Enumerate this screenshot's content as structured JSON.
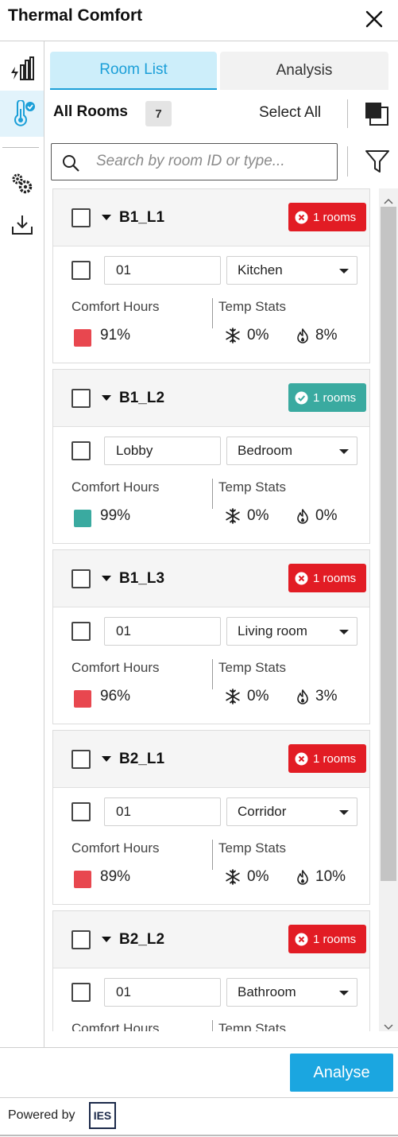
{
  "header": {
    "title": "Thermal Comfort",
    "close_icon": "close-icon"
  },
  "rail": {
    "items": [
      {
        "name": "energy-chart-icon",
        "active": false
      },
      {
        "name": "thermometer-check-icon",
        "active": true
      },
      {
        "name": "settings-gears-icon",
        "active": false
      },
      {
        "name": "download-icon",
        "active": false
      }
    ]
  },
  "tabs": [
    {
      "label": "Room List",
      "active": true
    },
    {
      "label": "Analysis",
      "active": false
    }
  ],
  "toolbar": {
    "all_rooms_label": "All Rooms",
    "room_count": "7",
    "select_all_label": "Select All"
  },
  "search": {
    "placeholder": "Search by room ID or type..."
  },
  "labels": {
    "comfort_hours": "Comfort Hours",
    "temp_stats": "Temp Stats"
  },
  "colors": {
    "accent": "#1ba6e0",
    "status_fail": "#e21c24",
    "status_pass": "#3aaaa0",
    "swatch_fail": "#e8474f",
    "swatch_pass": "#3aaaa0"
  },
  "groups": [
    {
      "name": "B1_L1",
      "status": "fail",
      "badge": "1 rooms",
      "room": {
        "id": "01",
        "type": "Kitchen",
        "comfort": "91%",
        "cold": "0%",
        "hot": "8%"
      }
    },
    {
      "name": "B1_L2",
      "status": "pass",
      "badge": "1 rooms",
      "room": {
        "id": "Lobby",
        "type": "Bedroom",
        "comfort": "99%",
        "cold": "0%",
        "hot": "0%"
      }
    },
    {
      "name": "B1_L3",
      "status": "fail",
      "badge": "1 rooms",
      "room": {
        "id": "01",
        "type": "Living room",
        "comfort": "96%",
        "cold": "0%",
        "hot": "3%"
      }
    },
    {
      "name": "B2_L1",
      "status": "fail",
      "badge": "1 rooms",
      "room": {
        "id": "01",
        "type": "Corridor",
        "comfort": "89%",
        "cold": "0%",
        "hot": "10%"
      }
    },
    {
      "name": "B2_L2",
      "status": "fail",
      "badge": "1 rooms",
      "room": {
        "id": "01",
        "type": "Bathroom",
        "comfort": "",
        "cold": "",
        "hot": ""
      }
    }
  ],
  "footer": {
    "analyse_label": "Analyse",
    "powered_by": "Powered by",
    "brand": "IES"
  }
}
